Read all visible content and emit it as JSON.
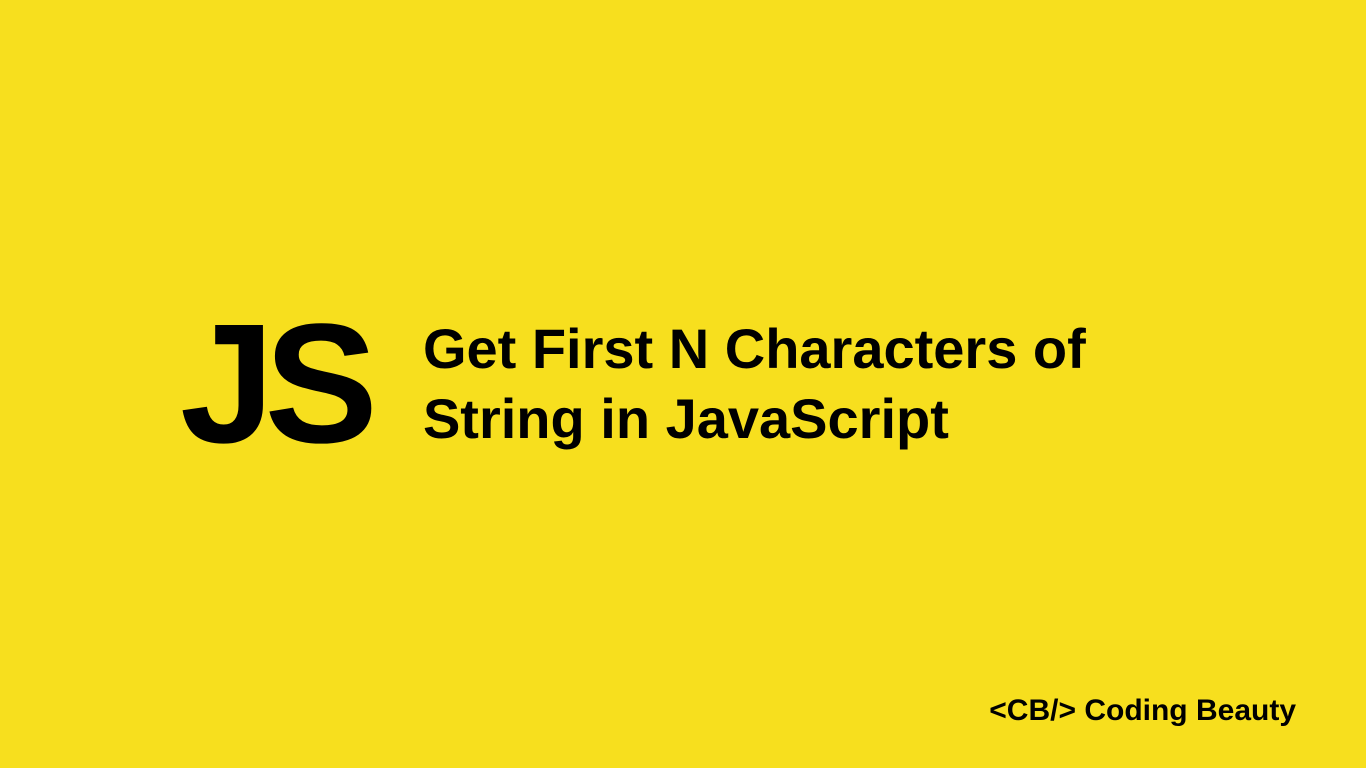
{
  "logo": {
    "text": "JS"
  },
  "title": {
    "line1": "Get First N Characters of",
    "line2": "String in JavaScript"
  },
  "branding": {
    "tag": "<CB/>",
    "name": "Coding Beauty"
  },
  "colors": {
    "background": "#F7DF1E",
    "text": "#000000"
  }
}
